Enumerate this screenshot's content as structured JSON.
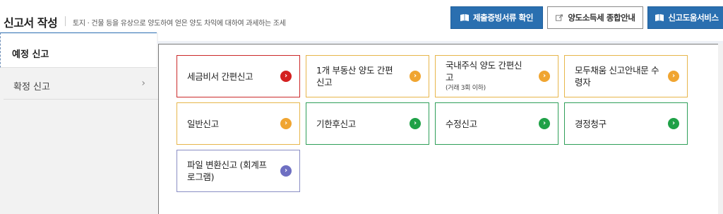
{
  "header": {
    "title": "신고서 작성",
    "subtitle": "토지 · 건물 등을 유상으로 양도하여 얻은 양도 차익에 대하여 과세하는 조세",
    "buttons": [
      {
        "label": "제출증빙서류 확인",
        "style": "blue",
        "icon": "book-icon"
      },
      {
        "label": "양도소득세 종합안내",
        "style": "white",
        "icon": "external-link-icon"
      },
      {
        "label": "신고도움서비스",
        "style": "blue",
        "icon": "book-icon"
      }
    ]
  },
  "sidebar": {
    "items": [
      {
        "label": "예정 신고",
        "active": true
      },
      {
        "label": "확정 신고",
        "active": false,
        "icon": "chevron-right-icon"
      }
    ]
  },
  "cards": [
    {
      "label": "세금비서 간편신고",
      "sub": "",
      "color": "red"
    },
    {
      "label": "1개 부동산 양도 간편 신고",
      "sub": "",
      "color": "orange"
    },
    {
      "label": "국내주식 양도 간편신고",
      "sub": "(거래 3회 이하)",
      "color": "orange"
    },
    {
      "label": "모두채움 신고안내문 수령자",
      "sub": "",
      "color": "orange"
    },
    {
      "label": "일반신고",
      "sub": "",
      "color": "orange"
    },
    {
      "label": "기한후신고",
      "sub": "",
      "color": "green"
    },
    {
      "label": "수정신고",
      "sub": "",
      "color": "green"
    },
    {
      "label": "경정청구",
      "sub": "",
      "color": "green"
    },
    {
      "label": "파일 변환신고 (회계프로그램)",
      "sub": "",
      "color": "purple"
    }
  ],
  "colors": {
    "primary_blue": "#2a6fb0",
    "red": "#d42020",
    "orange": "#f0a531",
    "green": "#1fa147",
    "purple": "#6e6fc2"
  }
}
